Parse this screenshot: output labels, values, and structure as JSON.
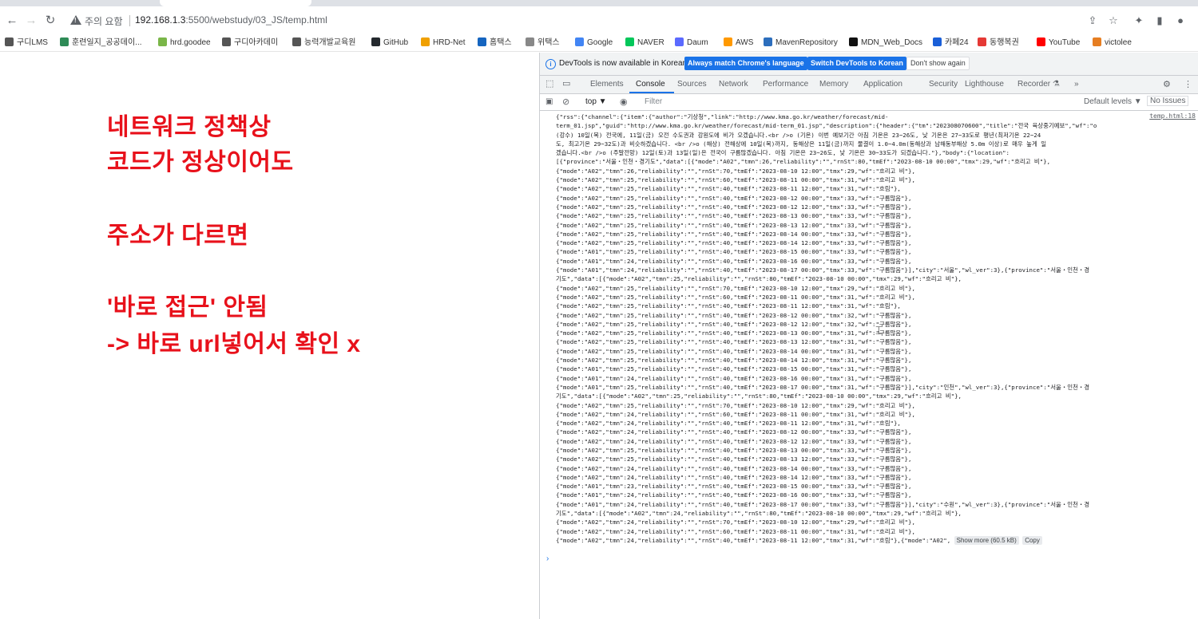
{
  "browser": {
    "security_label": "주의 요함",
    "url_host": "192.168.1.3",
    "url_rest": ":5500/webstudy/03_JS/temp.html"
  },
  "bookmarks": [
    "구디LMS",
    "훈련일지_공공데이...",
    "hrd.goodee",
    "구디아카데미",
    "능력개발교육원",
    "GitHub",
    "HRD-Net",
    "홈택스",
    "위택스",
    "Google",
    "NAVER",
    "Daum",
    "AWS",
    "MavenRepository",
    "MDN_Web_Docs",
    "카페24",
    "동행복권",
    "YouTube",
    "victolee"
  ],
  "page_note": {
    "line1": "네트워크 정책상",
    "line2": "코드가 정상이어도",
    "line3": "주소가 다르면",
    "line4": "'바로 접근' 안됨",
    "line5": "-> 바로 url넣어서 확인 x"
  },
  "devtools": {
    "info_message": "DevTools is now available in Korean!",
    "btn_match": "Always match Chrome's language",
    "btn_switch": "Switch DevTools to Korean",
    "btn_dismiss": "Don't show again",
    "tabs": [
      "Elements",
      "Console",
      "Sources",
      "Network",
      "Performance",
      "Memory",
      "Application",
      "Security",
      "Lighthouse",
      "Recorder ⚗"
    ],
    "active_tab": "Console",
    "more_tabs": "»",
    "context": "top ▼",
    "filter_placeholder": "Filter",
    "default_levels": "Default levels ▼",
    "no_issues": "No Issues",
    "source_link": "temp.html:18",
    "show_more": "Show more (60.5 kB)",
    "copy": "Copy",
    "prompt_symbol": "›"
  },
  "console_log": [
    "{\"rss\":{\"channel\":{\"item\":{\"author\":\"기상청\",\"link\":\"http://www.kma.go.kr/weather/forecast/mid-",
    "term_01.jsp\",\"guid\":\"http://www.kma.go.kr/weather/forecast/mid-term_01.jsp\",\"description\":{\"header\":{\"tm\":\"202308070600\",\"title\":\"전국 육상중기예보\",\"wf\":\"o",
    "(강수) 10일(목) 전국에, 11일(금) 오전 수도권과 강원도에 비가 오겠습니다.<br />o (기온) 이번 예보기간 아침 기온은 23~26도, 낮 기온은 27~33도로 평년(최저기온 22~24",
    "도, 최고기온 29~32도)과 비슷하겠습니다. <br />o (해상) 전해상에 10일(목)까지, 동해상은 11일(금)까지 물결이 1.0~4.0m(동해상과 남해동부해상 5.0m 이상)로 매우 높게 일",
    "겠습니다.<br />o (주말전망) 12일(토)과 13일(일)은 전국이 구름많겠습니다. 아침 기온은 23~26도, 낮 기온은 30~33도가 되겠습니다.\"},\"body\":{\"location\":",
    "[{\"province\":\"서울・인천・경기도\",\"data\":[{\"mode\":\"A02\",\"tmn\":26,\"reliability\":\"\",\"rnSt\":80,\"tmEf\":\"2023-08-10 00:00\",\"tmx\":29,\"wf\":\"흐리고 비\"},",
    "{\"mode\":\"A02\",\"tmn\":26,\"reliability\":\"\",\"rnSt\":70,\"tmEf\":\"2023-08-10 12:00\",\"tmx\":29,\"wf\":\"흐리고 비\"},",
    "{\"mode\":\"A02\",\"tmn\":25,\"reliability\":\"\",\"rnSt\":60,\"tmEf\":\"2023-08-11 00:00\",\"tmx\":31,\"wf\":\"흐리고 비\"},",
    "{\"mode\":\"A02\",\"tmn\":25,\"reliability\":\"\",\"rnSt\":40,\"tmEf\":\"2023-08-11 12:00\",\"tmx\":31,\"wf\":\"흐림\"},",
    "{\"mode\":\"A02\",\"tmn\":25,\"reliability\":\"\",\"rnSt\":40,\"tmEf\":\"2023-08-12 00:00\",\"tmx\":33,\"wf\":\"구름많음\"},",
    "{\"mode\":\"A02\",\"tmn\":25,\"reliability\":\"\",\"rnSt\":40,\"tmEf\":\"2023-08-12 12:00\",\"tmx\":33,\"wf\":\"구름많음\"},",
    "{\"mode\":\"A02\",\"tmn\":25,\"reliability\":\"\",\"rnSt\":40,\"tmEf\":\"2023-08-13 00:00\",\"tmx\":33,\"wf\":\"구름많음\"},",
    "{\"mode\":\"A02\",\"tmn\":25,\"reliability\":\"\",\"rnSt\":40,\"tmEf\":\"2023-08-13 12:00\",\"tmx\":33,\"wf\":\"구름많음\"},",
    "{\"mode\":\"A02\",\"tmn\":25,\"reliability\":\"\",\"rnSt\":40,\"tmEf\":\"2023-08-14 00:00\",\"tmx\":33,\"wf\":\"구름많음\"},",
    "{\"mode\":\"A02\",\"tmn\":25,\"reliability\":\"\",\"rnSt\":40,\"tmEf\":\"2023-08-14 12:00\",\"tmx\":33,\"wf\":\"구름많음\"},",
    "{\"mode\":\"A01\",\"tmn\":25,\"reliability\":\"\",\"rnSt\":40,\"tmEf\":\"2023-08-15 00:00\",\"tmx\":33,\"wf\":\"구름많음\"},",
    "{\"mode\":\"A01\",\"tmn\":24,\"reliability\":\"\",\"rnSt\":40,\"tmEf\":\"2023-08-16 00:00\",\"tmx\":33,\"wf\":\"구름많음\"},",
    "{\"mode\":\"A01\",\"tmn\":24,\"reliability\":\"\",\"rnSt\":40,\"tmEf\":\"2023-08-17 00:00\",\"tmx\":33,\"wf\":\"구름많음\"}],\"city\":\"서울\",\"wl_ver\":3},{\"province\":\"서울・인천・경",
    "기도\",\"data\":[{\"mode\":\"A02\",\"tmn\":25,\"reliability\":\"\",\"rnSt\":80,\"tmEf\":\"2023-08-10 00:00\",\"tmx\":29,\"wf\":\"흐리고 비\"},",
    "{\"mode\":\"A02\",\"tmn\":25,\"reliability\":\"\",\"rnSt\":70,\"tmEf\":\"2023-08-10 12:00\",\"tmx\":29,\"wf\":\"흐리고 비\"},",
    "{\"mode\":\"A02\",\"tmn\":25,\"reliability\":\"\",\"rnSt\":60,\"tmEf\":\"2023-08-11 00:00\",\"tmx\":31,\"wf\":\"흐리고 비\"},",
    "{\"mode\":\"A02\",\"tmn\":25,\"reliability\":\"\",\"rnSt\":40,\"tmEf\":\"2023-08-11 12:00\",\"tmx\":31,\"wf\":\"흐림\"},",
    "{\"mode\":\"A02\",\"tmn\":25,\"reliability\":\"\",\"rnSt\":40,\"tmEf\":\"2023-08-12 00:00\",\"tmx\":32,\"wf\":\"구름많음\"},",
    "{\"mode\":\"A02\",\"tmn\":25,\"reliability\":\"\",\"rnSt\":40,\"tmEf\":\"2023-08-12 12:00\",\"tmx\":32,\"wf\":\"구름많음\"},",
    "{\"mode\":\"A02\",\"tmn\":25,\"reliability\":\"\",\"rnSt\":40,\"tmEf\":\"2023-08-13 00:00\",\"tmx\":31,\"wf\":\"구름많음\"},",
    "{\"mode\":\"A02\",\"tmn\":25,\"reliability\":\"\",\"rnSt\":40,\"tmEf\":\"2023-08-13 12:00\",\"tmx\":31,\"wf\":\"구름많음\"},",
    "{\"mode\":\"A02\",\"tmn\":25,\"reliability\":\"\",\"rnSt\":40,\"tmEf\":\"2023-08-14 00:00\",\"tmx\":31,\"wf\":\"구름많음\"},",
    "{\"mode\":\"A02\",\"tmn\":25,\"reliability\":\"\",\"rnSt\":40,\"tmEf\":\"2023-08-14 12:00\",\"tmx\":31,\"wf\":\"구름많음\"},",
    "{\"mode\":\"A01\",\"tmn\":25,\"reliability\":\"\",\"rnSt\":40,\"tmEf\":\"2023-08-15 00:00\",\"tmx\":31,\"wf\":\"구름많음\"},",
    "{\"mode\":\"A01\",\"tmn\":24,\"reliability\":\"\",\"rnSt\":40,\"tmEf\":\"2023-08-16 00:00\",\"tmx\":31,\"wf\":\"구름많음\"},",
    "{\"mode\":\"A01\",\"tmn\":25,\"reliability\":\"\",\"rnSt\":40,\"tmEf\":\"2023-08-17 00:00\",\"tmx\":31,\"wf\":\"구름많음\"}],\"city\":\"인천\",\"wl_ver\":3},{\"province\":\"서울・인천・경",
    "기도\",\"data\":[{\"mode\":\"A02\",\"tmn\":25,\"reliability\":\"\",\"rnSt\":80,\"tmEf\":\"2023-08-10 00:00\",\"tmx\":29,\"wf\":\"흐리고 비\"},",
    "{\"mode\":\"A02\",\"tmn\":25,\"reliability\":\"\",\"rnSt\":70,\"tmEf\":\"2023-08-10 12:00\",\"tmx\":29,\"wf\":\"흐리고 비\"},",
    "{\"mode\":\"A02\",\"tmn\":24,\"reliability\":\"\",\"rnSt\":60,\"tmEf\":\"2023-08-11 00:00\",\"tmx\":31,\"wf\":\"흐리고 비\"},",
    "{\"mode\":\"A02\",\"tmn\":24,\"reliability\":\"\",\"rnSt\":40,\"tmEf\":\"2023-08-11 12:00\",\"tmx\":31,\"wf\":\"흐림\"},",
    "{\"mode\":\"A02\",\"tmn\":24,\"reliability\":\"\",\"rnSt\":40,\"tmEf\":\"2023-08-12 00:00\",\"tmx\":33,\"wf\":\"구름많음\"},",
    "{\"mode\":\"A02\",\"tmn\":24,\"reliability\":\"\",\"rnSt\":40,\"tmEf\":\"2023-08-12 12:00\",\"tmx\":33,\"wf\":\"구름많음\"},",
    "{\"mode\":\"A02\",\"tmn\":25,\"reliability\":\"\",\"rnSt\":40,\"tmEf\":\"2023-08-13 00:00\",\"tmx\":33,\"wf\":\"구름많음\"},",
    "{\"mode\":\"A02\",\"tmn\":25,\"reliability\":\"\",\"rnSt\":40,\"tmEf\":\"2023-08-13 12:00\",\"tmx\":33,\"wf\":\"구름많음\"},",
    "{\"mode\":\"A02\",\"tmn\":24,\"reliability\":\"\",\"rnSt\":40,\"tmEf\":\"2023-08-14 00:00\",\"tmx\":33,\"wf\":\"구름많음\"},",
    "{\"mode\":\"A02\",\"tmn\":24,\"reliability\":\"\",\"rnSt\":40,\"tmEf\":\"2023-08-14 12:00\",\"tmx\":33,\"wf\":\"구름많음\"},",
    "{\"mode\":\"A01\",\"tmn\":23,\"reliability\":\"\",\"rnSt\":40,\"tmEf\":\"2023-08-15 00:00\",\"tmx\":33,\"wf\":\"구름많음\"},",
    "{\"mode\":\"A01\",\"tmn\":24,\"reliability\":\"\",\"rnSt\":40,\"tmEf\":\"2023-08-16 00:00\",\"tmx\":33,\"wf\":\"구름많음\"},",
    "{\"mode\":\"A01\",\"tmn\":24,\"reliability\":\"\",\"rnSt\":40,\"tmEf\":\"2023-08-17 00:00\",\"tmx\":33,\"wf\":\"구름많음\"}],\"city\":\"수원\",\"wl_ver\":3},{\"province\":\"서울・인천・경",
    "기도\",\"data\":[{\"mode\":\"A02\",\"tmn\":24,\"reliability\":\"\",\"rnSt\":80,\"tmEf\":\"2023-08-10 00:00\",\"tmx\":29,\"wf\":\"흐리고 비\"},",
    "{\"mode\":\"A02\",\"tmn\":24,\"reliability\":\"\",\"rnSt\":70,\"tmEf\":\"2023-08-10 12:00\",\"tmx\":29,\"wf\":\"흐리고 비\"},",
    "{\"mode\":\"A02\",\"tmn\":24,\"reliability\":\"\",\"rnSt\":60,\"tmEf\":\"2023-08-11 00:00\",\"tmx\":31,\"wf\":\"흐리고 비\"},"
  ],
  "console_last_line": "{\"mode\":\"A02\",\"tmn\":24,\"reliability\":\"\",\"rnSt\":40,\"tmEf\":\"2023-08-11 12:00\",\"tmx\":31,\"wf\":\"흐림\"},{\"mode\":\"A02\", "
}
